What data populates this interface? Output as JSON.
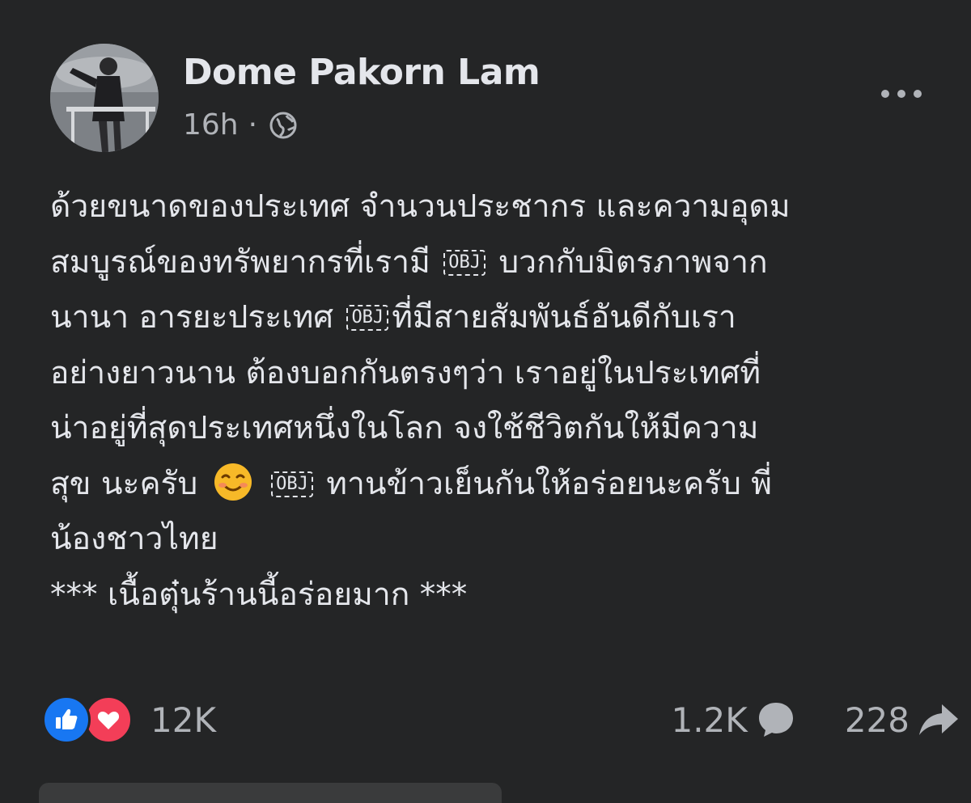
{
  "post": {
    "author": "Dome Pakorn Lam",
    "time": "16h",
    "separator": "·",
    "privacy_icon": "globe-icon",
    "more_icon": "more-options-icon",
    "lines": [
      "ด้วยขนาดของประเทศ จำนวนประชากร และความอุดม",
      "สมบูรณ์ของทรัพยากรที่เรามี",
      "บวกกับมิตรภาพจาก",
      "นานา อารยะประเทศ",
      "ที่มีสายสัมพันธ์อันดีกับเรา",
      "อย่างยาวนาน ต้องบอกกันตรงๆว่า เราอยู่ในประเทศที่",
      "น่าอยู่ที่สุดประเทศหนึ่งในโลก จงใช้ชีวิตกันให้มีความ",
      "สุข นะครับ",
      "ทานข้าวเย็นกันให้อร่อยนะครับ พี่",
      "น้องชาวไทย",
      "*** เนื้อตุ๋นร้านนี้อร่อยมาก ***"
    ],
    "obj_placeholder": "OBJ",
    "emoji": "smiling-face-icon"
  },
  "reactions": {
    "like_icon": "like-icon",
    "love_icon": "love-icon",
    "count": "12K",
    "colors": {
      "like": "#1877f2",
      "love": "#f33e58"
    }
  },
  "stats": {
    "comments": "1.2K",
    "comment_icon": "comment-icon",
    "shares": "228",
    "share_icon": "share-icon"
  },
  "theme": {
    "background": "#242526",
    "text": "#e4e6eb",
    "secondary_text": "#b0b3b8"
  }
}
